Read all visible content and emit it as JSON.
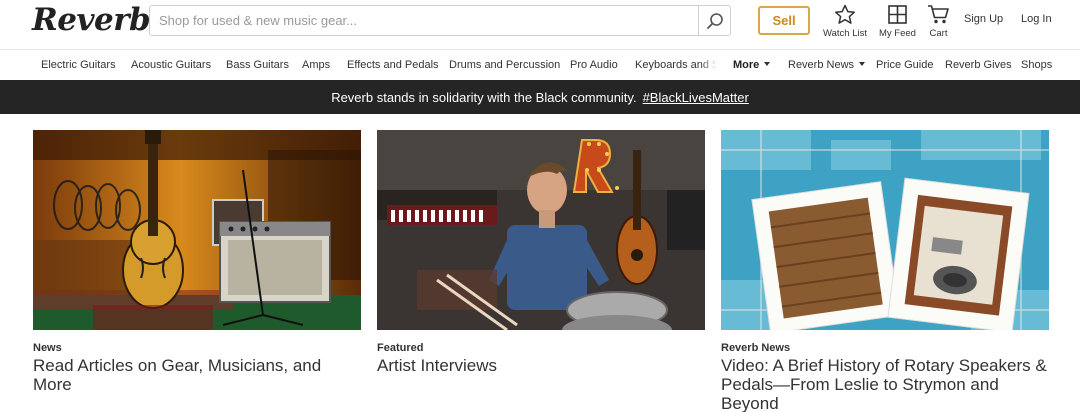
{
  "header": {
    "logo": "Reverb",
    "search_placeholder": "Shop for used & new music gear...",
    "sell_label": "Sell",
    "watch_list_label": "Watch List",
    "my_feed_label": "My Feed",
    "cart_label": "Cart",
    "sign_up_label": "Sign Up",
    "log_in_label": "Log In",
    "accent_color": "#d9a64a"
  },
  "nav": {
    "categories": [
      "Electric Guitars",
      "Acoustic Guitars",
      "Bass Guitars",
      "Amps",
      "Effects and Pedals",
      "Drums and Percussion",
      "Pro Audio",
      "Keyboards and Synths"
    ],
    "more_label": "More",
    "reverb_news_label": "Reverb News",
    "price_guide_label": "Price Guide",
    "reverb_gives_label": "Reverb Gives",
    "shops_label": "Shops"
  },
  "banner": {
    "text": "Reverb stands in solidarity with the Black community.",
    "hashtag": "#BlackLivesMatter"
  },
  "cards": [
    {
      "kicker": "News",
      "title": "Read Articles on Gear, Musicians, and More"
    },
    {
      "kicker": "Featured",
      "title": "Artist Interviews"
    },
    {
      "kicker": "Reverb News",
      "title": "Video: A Brief History of Rotary Speakers & Pedals—From Leslie to Strymon and Beyond"
    }
  ]
}
